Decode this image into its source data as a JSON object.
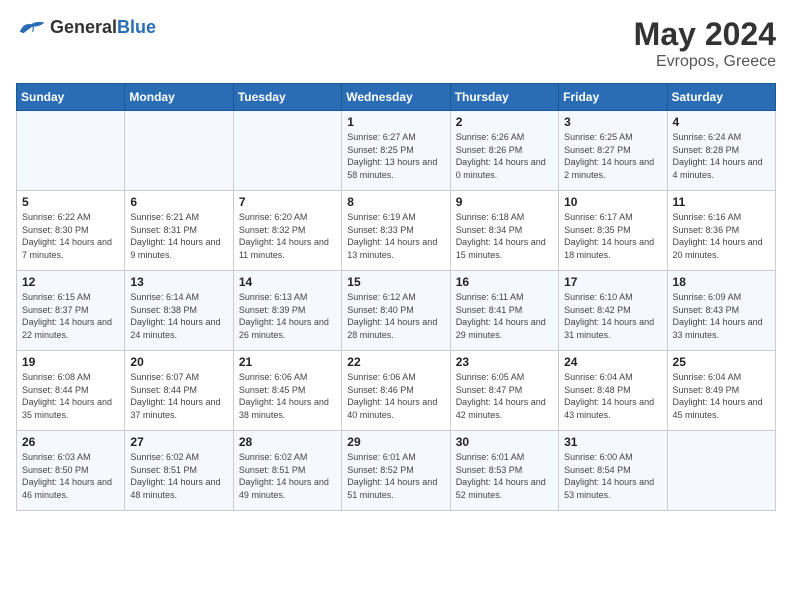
{
  "header": {
    "logo_text_general": "General",
    "logo_text_blue": "Blue",
    "month": "May 2024",
    "location": "Evropos, Greece"
  },
  "calendar": {
    "days_of_week": [
      "Sunday",
      "Monday",
      "Tuesday",
      "Wednesday",
      "Thursday",
      "Friday",
      "Saturday"
    ],
    "weeks": [
      [
        {
          "day": "",
          "sunrise": "",
          "sunset": "",
          "daylight": ""
        },
        {
          "day": "",
          "sunrise": "",
          "sunset": "",
          "daylight": ""
        },
        {
          "day": "",
          "sunrise": "",
          "sunset": "",
          "daylight": ""
        },
        {
          "day": "1",
          "sunrise": "Sunrise: 6:27 AM",
          "sunset": "Sunset: 8:25 PM",
          "daylight": "Daylight: 13 hours and 58 minutes."
        },
        {
          "day": "2",
          "sunrise": "Sunrise: 6:26 AM",
          "sunset": "Sunset: 8:26 PM",
          "daylight": "Daylight: 14 hours and 0 minutes."
        },
        {
          "day": "3",
          "sunrise": "Sunrise: 6:25 AM",
          "sunset": "Sunset: 8:27 PM",
          "daylight": "Daylight: 14 hours and 2 minutes."
        },
        {
          "day": "4",
          "sunrise": "Sunrise: 6:24 AM",
          "sunset": "Sunset: 8:28 PM",
          "daylight": "Daylight: 14 hours and 4 minutes."
        }
      ],
      [
        {
          "day": "5",
          "sunrise": "Sunrise: 6:22 AM",
          "sunset": "Sunset: 8:30 PM",
          "daylight": "Daylight: 14 hours and 7 minutes."
        },
        {
          "day": "6",
          "sunrise": "Sunrise: 6:21 AM",
          "sunset": "Sunset: 8:31 PM",
          "daylight": "Daylight: 14 hours and 9 minutes."
        },
        {
          "day": "7",
          "sunrise": "Sunrise: 6:20 AM",
          "sunset": "Sunset: 8:32 PM",
          "daylight": "Daylight: 14 hours and 11 minutes."
        },
        {
          "day": "8",
          "sunrise": "Sunrise: 6:19 AM",
          "sunset": "Sunset: 8:33 PM",
          "daylight": "Daylight: 14 hours and 13 minutes."
        },
        {
          "day": "9",
          "sunrise": "Sunrise: 6:18 AM",
          "sunset": "Sunset: 8:34 PM",
          "daylight": "Daylight: 14 hours and 15 minutes."
        },
        {
          "day": "10",
          "sunrise": "Sunrise: 6:17 AM",
          "sunset": "Sunset: 8:35 PM",
          "daylight": "Daylight: 14 hours and 18 minutes."
        },
        {
          "day": "11",
          "sunrise": "Sunrise: 6:16 AM",
          "sunset": "Sunset: 8:36 PM",
          "daylight": "Daylight: 14 hours and 20 minutes."
        }
      ],
      [
        {
          "day": "12",
          "sunrise": "Sunrise: 6:15 AM",
          "sunset": "Sunset: 8:37 PM",
          "daylight": "Daylight: 14 hours and 22 minutes."
        },
        {
          "day": "13",
          "sunrise": "Sunrise: 6:14 AM",
          "sunset": "Sunset: 8:38 PM",
          "daylight": "Daylight: 14 hours and 24 minutes."
        },
        {
          "day": "14",
          "sunrise": "Sunrise: 6:13 AM",
          "sunset": "Sunset: 8:39 PM",
          "daylight": "Daylight: 14 hours and 26 minutes."
        },
        {
          "day": "15",
          "sunrise": "Sunrise: 6:12 AM",
          "sunset": "Sunset: 8:40 PM",
          "daylight": "Daylight: 14 hours and 28 minutes."
        },
        {
          "day": "16",
          "sunrise": "Sunrise: 6:11 AM",
          "sunset": "Sunset: 8:41 PM",
          "daylight": "Daylight: 14 hours and 29 minutes."
        },
        {
          "day": "17",
          "sunrise": "Sunrise: 6:10 AM",
          "sunset": "Sunset: 8:42 PM",
          "daylight": "Daylight: 14 hours and 31 minutes."
        },
        {
          "day": "18",
          "sunrise": "Sunrise: 6:09 AM",
          "sunset": "Sunset: 8:43 PM",
          "daylight": "Daylight: 14 hours and 33 minutes."
        }
      ],
      [
        {
          "day": "19",
          "sunrise": "Sunrise: 6:08 AM",
          "sunset": "Sunset: 8:44 PM",
          "daylight": "Daylight: 14 hours and 35 minutes."
        },
        {
          "day": "20",
          "sunrise": "Sunrise: 6:07 AM",
          "sunset": "Sunset: 8:44 PM",
          "daylight": "Daylight: 14 hours and 37 minutes."
        },
        {
          "day": "21",
          "sunrise": "Sunrise: 6:06 AM",
          "sunset": "Sunset: 8:45 PM",
          "daylight": "Daylight: 14 hours and 38 minutes."
        },
        {
          "day": "22",
          "sunrise": "Sunrise: 6:06 AM",
          "sunset": "Sunset: 8:46 PM",
          "daylight": "Daylight: 14 hours and 40 minutes."
        },
        {
          "day": "23",
          "sunrise": "Sunrise: 6:05 AM",
          "sunset": "Sunset: 8:47 PM",
          "daylight": "Daylight: 14 hours and 42 minutes."
        },
        {
          "day": "24",
          "sunrise": "Sunrise: 6:04 AM",
          "sunset": "Sunset: 8:48 PM",
          "daylight": "Daylight: 14 hours and 43 minutes."
        },
        {
          "day": "25",
          "sunrise": "Sunrise: 6:04 AM",
          "sunset": "Sunset: 8:49 PM",
          "daylight": "Daylight: 14 hours and 45 minutes."
        }
      ],
      [
        {
          "day": "26",
          "sunrise": "Sunrise: 6:03 AM",
          "sunset": "Sunset: 8:50 PM",
          "daylight": "Daylight: 14 hours and 46 minutes."
        },
        {
          "day": "27",
          "sunrise": "Sunrise: 6:02 AM",
          "sunset": "Sunset: 8:51 PM",
          "daylight": "Daylight: 14 hours and 48 minutes."
        },
        {
          "day": "28",
          "sunrise": "Sunrise: 6:02 AM",
          "sunset": "Sunset: 8:51 PM",
          "daylight": "Daylight: 14 hours and 49 minutes."
        },
        {
          "day": "29",
          "sunrise": "Sunrise: 6:01 AM",
          "sunset": "Sunset: 8:52 PM",
          "daylight": "Daylight: 14 hours and 51 minutes."
        },
        {
          "day": "30",
          "sunrise": "Sunrise: 6:01 AM",
          "sunset": "Sunset: 8:53 PM",
          "daylight": "Daylight: 14 hours and 52 minutes."
        },
        {
          "day": "31",
          "sunrise": "Sunrise: 6:00 AM",
          "sunset": "Sunset: 8:54 PM",
          "daylight": "Daylight: 14 hours and 53 minutes."
        },
        {
          "day": "",
          "sunrise": "",
          "sunset": "",
          "daylight": ""
        }
      ]
    ]
  }
}
